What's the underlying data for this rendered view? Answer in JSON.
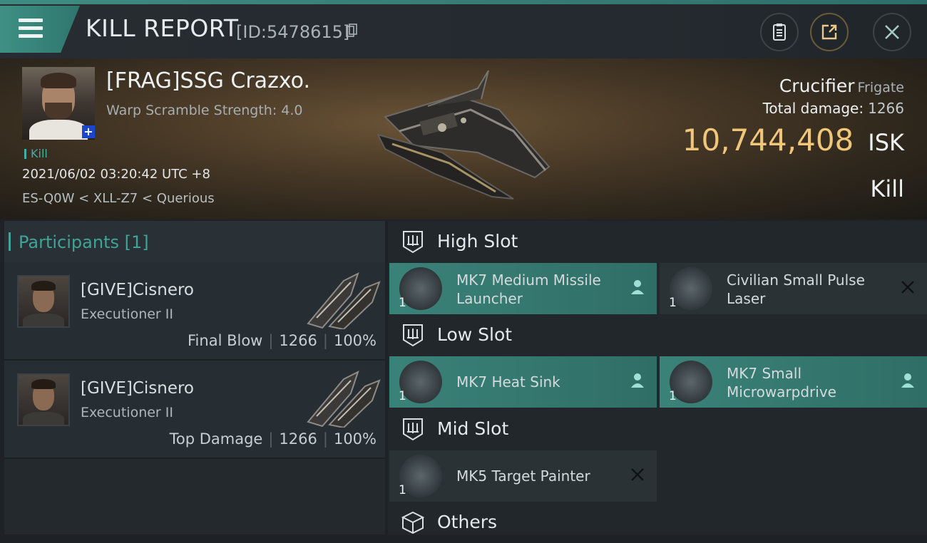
{
  "header": {
    "title": "KILL REPORT",
    "report_id": "[ID:5478615]"
  },
  "victim": {
    "name": "[FRAG]SSG Crazxo.",
    "warp_scramble": "Warp Scramble Strength: 4.0",
    "tag": "Kill",
    "datetime": "2021/06/02 03:20:42 UTC +8",
    "location": "ES-Q0W < XLL-Z7 < Querious",
    "ship_name": "Crucifier",
    "ship_class": "Frigate",
    "total_damage_label": "Total damage:",
    "total_damage": "1266",
    "isk_value": "10,744,408",
    "isk_unit": "ISK",
    "result": "Kill"
  },
  "participants": {
    "header": "Participants [1]",
    "rows": [
      {
        "name": "[GIVE]Cisnero",
        "ship": "Executioner II",
        "role": "Final Blow",
        "damage": "1266",
        "percent": "100%"
      },
      {
        "name": "[GIVE]Cisnero",
        "ship": "Executioner II",
        "role": "Top Damage",
        "damage": "1266",
        "percent": "100%"
      }
    ]
  },
  "fitting": {
    "high_slot": {
      "label": "High Slot",
      "items": [
        {
          "name": "MK7 Medium Missile Launcher",
          "qty": "1",
          "state": "fitted"
        },
        {
          "name": "Civilian Small Pulse Laser",
          "qty": "1",
          "state": "destroyed"
        }
      ]
    },
    "low_slot": {
      "label": "Low Slot",
      "items": [
        {
          "name": "MK7 Heat Sink",
          "qty": "1",
          "state": "fitted"
        },
        {
          "name": "MK7 Small Microwarpdrive",
          "qty": "1",
          "state": "fitted"
        }
      ]
    },
    "mid_slot": {
      "label": "Mid Slot",
      "items": [
        {
          "name": "MK5 Target Painter",
          "qty": "1",
          "state": "destroyed"
        }
      ]
    },
    "others": {
      "label": "Others"
    }
  },
  "colors": {
    "accent": "#3fa497",
    "isk": "#f0c77a",
    "fitted_bg": "#3a8279"
  }
}
